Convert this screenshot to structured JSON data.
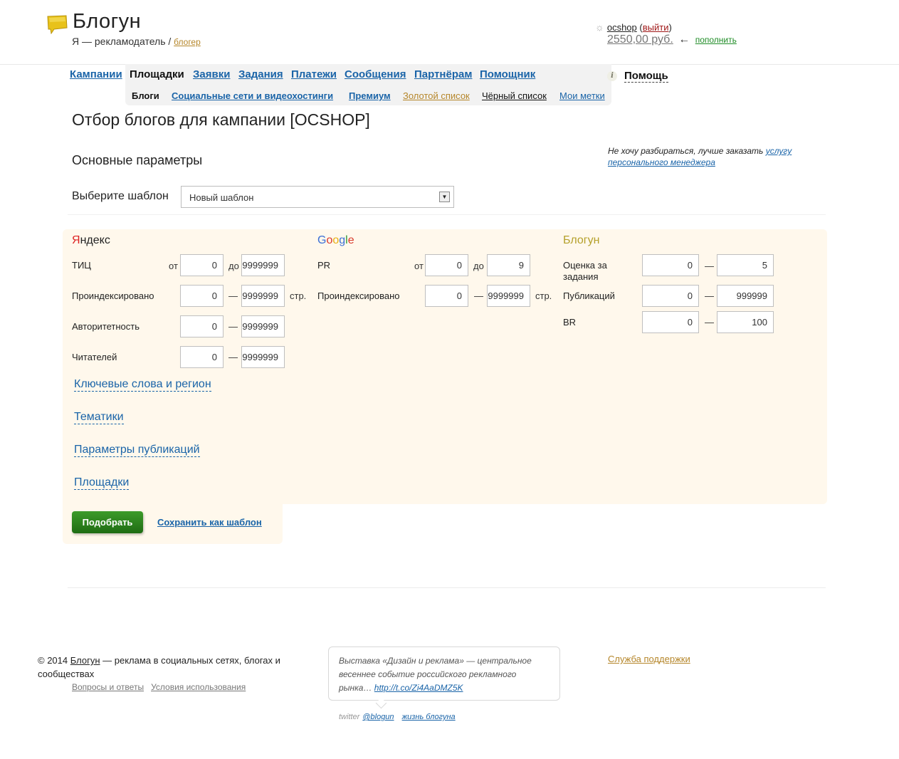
{
  "header": {
    "logo_text": "Блогун",
    "tagline_prefix": "Я — рекламодатель /",
    "tagline_link": "блогер",
    "user": {
      "name": "ocshop",
      "logout_open": "(",
      "logout": "выйти",
      "logout_close": ")",
      "balance": "2550,00 руб.",
      "arrow": "←",
      "topup": "пополнить"
    },
    "icons": {
      "logo": "speech-bubble-logo-icon",
      "settings": "gear-icon",
      "help": "info-icon"
    },
    "colors": {
      "logo": "#e8c21a",
      "link": "#1a64a8",
      "brand_gold": "#b5862a",
      "button": "#2a8a1c"
    }
  },
  "nav": {
    "items": [
      "Кампании",
      "Площадки",
      "Заявки",
      "Задания",
      "Платежи",
      "Сообщения",
      "Партнёрам",
      "Помощник"
    ],
    "active_index": 1,
    "sub_items": [
      "Блоги",
      "Социальные сети и видеохостинги",
      "Премиум",
      "Золотой список",
      "Чёрный список",
      "Мои метки"
    ],
    "sub_active_index": 0,
    "help": "Помощь"
  },
  "page": {
    "title": "Отбор блогов для кампании [OCSHOP]",
    "section_title": "Основные параметры",
    "side_note_text": "Не хочу разбираться, лучше заказать",
    "side_note_link": "услугу персонального менеджера",
    "template_label": "Выберите шаблон",
    "template_value": "Новый шаблон"
  },
  "filters": {
    "yandex": {
      "title": "Яндекс",
      "tic": {
        "label": "ТИЦ",
        "from_label": "от",
        "to_label": "до",
        "from": "0",
        "to": "9999999"
      },
      "indexed": {
        "label": "Проиндексировано",
        "from": "0",
        "to": "9999999",
        "unit": "стр."
      },
      "authority": {
        "label": "Авторитетность",
        "from": "0",
        "to": "9999999"
      },
      "readers": {
        "label": "Читателей",
        "from": "0",
        "to": "9999999"
      }
    },
    "google": {
      "title": "Google",
      "pr": {
        "label": "PR",
        "from_label": "от",
        "to_label": "до",
        "from": "0",
        "to": "9"
      },
      "indexed": {
        "label": "Проиндексировано",
        "from": "0",
        "to": "9999999",
        "unit": "стр."
      }
    },
    "blogun": {
      "title": "Блогун",
      "rating": {
        "label": "Оценка за задания",
        "from": "0",
        "to": "5"
      },
      "publications": {
        "label": "Публикаций",
        "from": "0",
        "to": "999999"
      },
      "br": {
        "label": "BR",
        "from": "0",
        "to": "100"
      }
    },
    "dash": "—",
    "links": [
      "Ключевые слова и регион",
      "Тематики",
      "Параметры публикаций",
      "Площадки"
    ]
  },
  "actions": {
    "pick": "Подобрать",
    "save_template": "Сохранить как шаблон"
  },
  "footer": {
    "copyright_prefix": "© 2014",
    "brand": "Блогун",
    "copyright_suffix": "— реклама в социальных сетях, блогах и сообществах",
    "faq": "Вопросы и ответы",
    "terms": "Условия использования",
    "tweet_text": "Выставка «Дизайн и реклама» — центральное весеннее событие российского рекламного рынка…",
    "tweet_link": "http://t.co/Zi4AaDMZ5K",
    "twitter_label": "twitter",
    "twitter_handle": "@blogun",
    "blog_link": "жизнь блогуна",
    "support": "Служба поддержки"
  }
}
